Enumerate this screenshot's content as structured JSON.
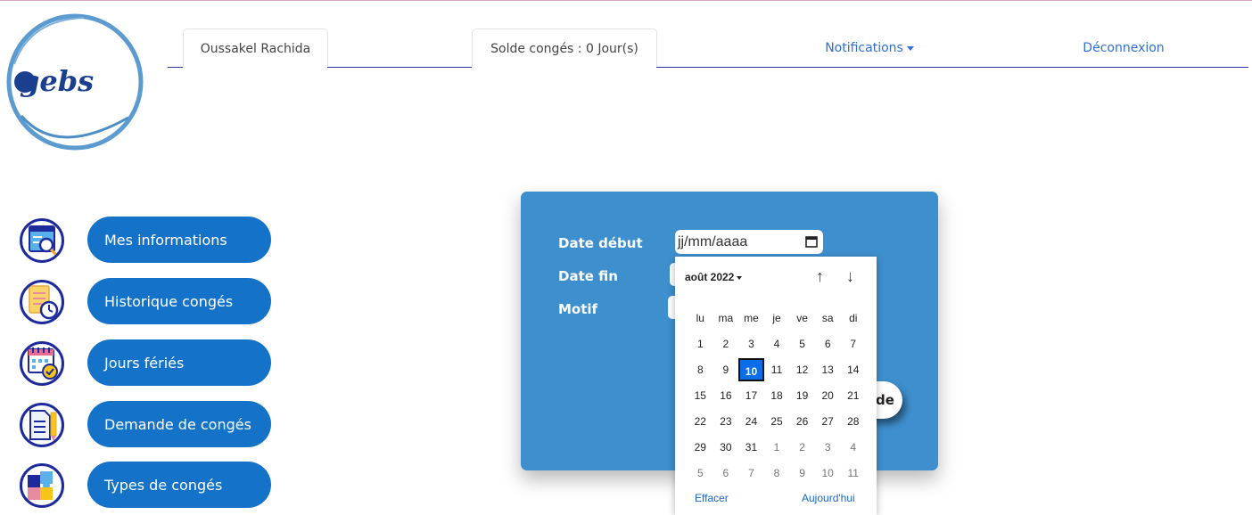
{
  "logo": {
    "text": "gebs"
  },
  "nav": {
    "user_name": "Oussakel Rachida",
    "solde": "Solde congés : 0 Jour(s)",
    "notifications": "Notifications",
    "logout": "Déconnexion"
  },
  "sidebar": {
    "items": [
      {
        "label": "Mes informations",
        "icon": "info-search-icon"
      },
      {
        "label": "Historique congés",
        "icon": "history-clock-icon"
      },
      {
        "label": "Jours fériés",
        "icon": "calendar-check-icon"
      },
      {
        "label": "Demande de congés",
        "icon": "document-pencil-icon"
      },
      {
        "label": "Types de congés",
        "icon": "puzzle-icon"
      }
    ]
  },
  "form": {
    "date_debut_label": "Date début",
    "date_fin_label": "Date fin",
    "motif_label": "Motif",
    "date_debut_placeholder": "jj/mm/aaaa",
    "submit_fragment": "de"
  },
  "datepicker": {
    "month": "août 2022",
    "weekdays": [
      "lu",
      "ma",
      "me",
      "je",
      "ve",
      "sa",
      "di"
    ],
    "weeks": [
      [
        {
          "d": "1"
        },
        {
          "d": "2"
        },
        {
          "d": "3"
        },
        {
          "d": "4"
        },
        {
          "d": "5"
        },
        {
          "d": "6"
        },
        {
          "d": "7"
        }
      ],
      [
        {
          "d": "8"
        },
        {
          "d": "9"
        },
        {
          "d": "10",
          "selected": true
        },
        {
          "d": "11"
        },
        {
          "d": "12"
        },
        {
          "d": "13"
        },
        {
          "d": "14"
        }
      ],
      [
        {
          "d": "15"
        },
        {
          "d": "16"
        },
        {
          "d": "17"
        },
        {
          "d": "18"
        },
        {
          "d": "19"
        },
        {
          "d": "20"
        },
        {
          "d": "21"
        }
      ],
      [
        {
          "d": "22"
        },
        {
          "d": "23"
        },
        {
          "d": "24"
        },
        {
          "d": "25"
        },
        {
          "d": "26"
        },
        {
          "d": "27"
        },
        {
          "d": "28"
        }
      ],
      [
        {
          "d": "29"
        },
        {
          "d": "30"
        },
        {
          "d": "31"
        },
        {
          "d": "1",
          "muted": true
        },
        {
          "d": "2",
          "muted": true
        },
        {
          "d": "3",
          "muted": true
        },
        {
          "d": "4",
          "muted": true
        }
      ],
      [
        {
          "d": "5",
          "muted": true
        },
        {
          "d": "6",
          "muted": true
        },
        {
          "d": "7",
          "muted": true
        },
        {
          "d": "8",
          "muted": true
        },
        {
          "d": "9",
          "muted": true
        },
        {
          "d": "10",
          "muted": true
        },
        {
          "d": "11",
          "muted": true
        }
      ]
    ],
    "clear": "Effacer",
    "today": "Aujourd'hui"
  },
  "colors": {
    "accent": "#1473c8",
    "panel": "#3e8fce",
    "nav_line": "#2b35a3",
    "selected_day": "#0b6ee8"
  }
}
